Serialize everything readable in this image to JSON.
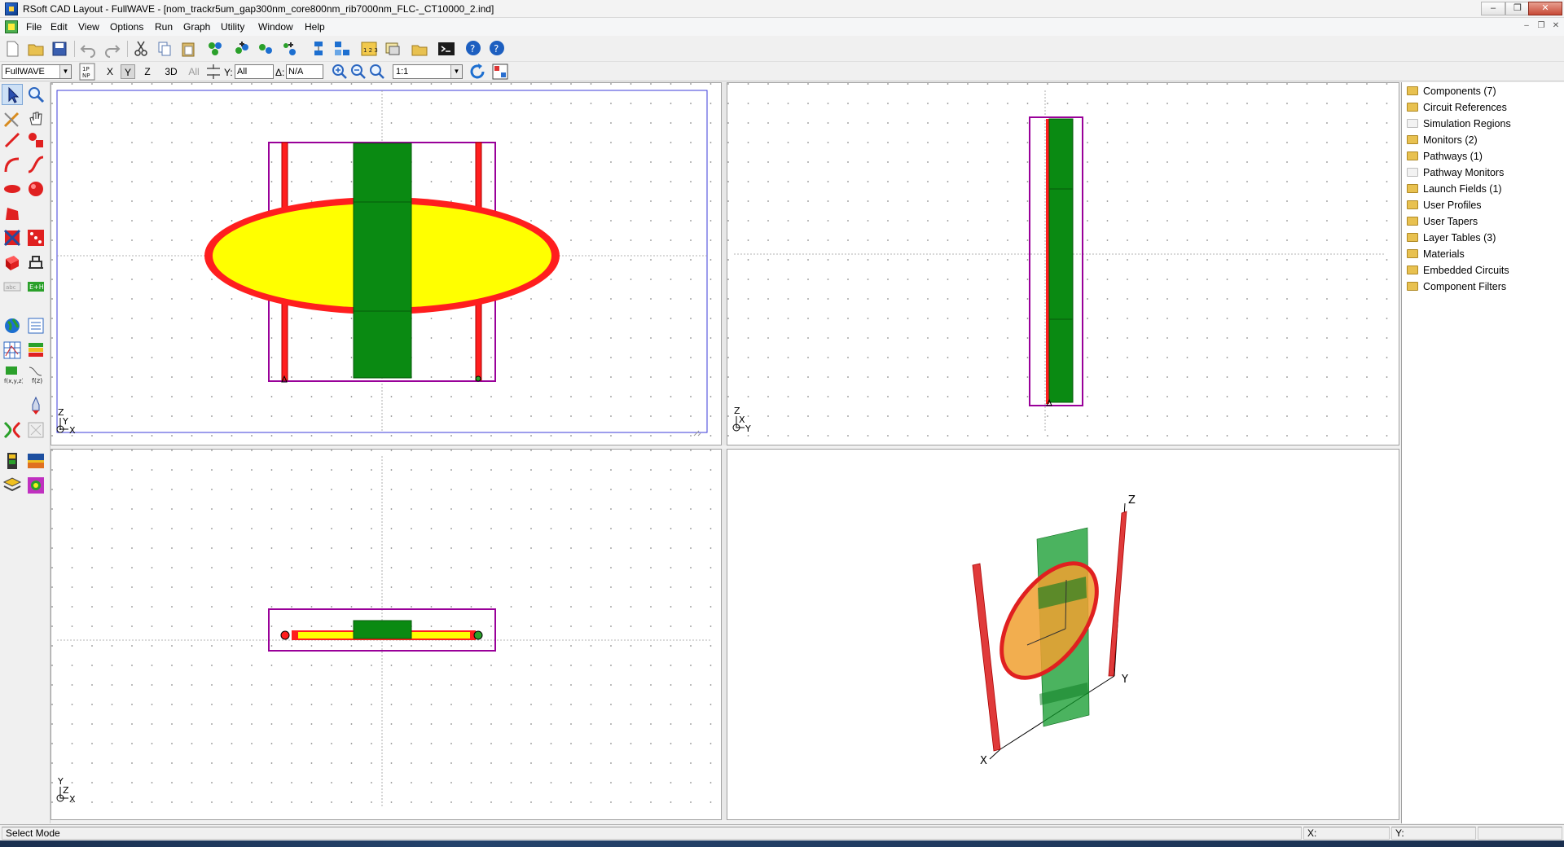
{
  "window": {
    "title": "RSoft CAD Layout - FullWAVE - [nom_trackr5um_gap300nm_core800nm_rib7000nm_FLC-_CT10000_2.ind]",
    "controls": [
      "–",
      "❐",
      "✕"
    ],
    "mdi_controls": [
      "–",
      "❐",
      "✕"
    ]
  },
  "menu": [
    "File",
    "Edit",
    "View",
    "Options",
    "Run",
    "Graph",
    "Utility",
    "Window",
    "Help"
  ],
  "toolbar2": {
    "program": "FullWAVE",
    "axes": [
      "X",
      "Y",
      "Z",
      "3D"
    ],
    "selected_axis": "Y",
    "all_label": "All",
    "y_label": "Y:",
    "y_value": "All",
    "delta_label": "Δ:",
    "delta_value": "N/A",
    "zoom_value": "1:1"
  },
  "views": {
    "top_left_axes": {
      "vertical": "Z",
      "horizontal": "X",
      "depth": "Y"
    },
    "top_right_axes": {
      "vertical": "Z",
      "horizontal": "Y",
      "depth": "X"
    },
    "bottom_left_axes": {
      "vertical": "Y",
      "horizontal": "X",
      "depth": "Z"
    },
    "three_d_axes": {
      "x": "X",
      "y": "Y",
      "z": "Z"
    }
  },
  "tree": [
    {
      "label": "Components (7)",
      "empty": false
    },
    {
      "label": "Circuit References",
      "empty": false
    },
    {
      "label": "Simulation Regions",
      "empty": true
    },
    {
      "label": "Monitors (2)",
      "empty": false
    },
    {
      "label": "Pathways (1)",
      "empty": false
    },
    {
      "label": "Pathway Monitors",
      "empty": true
    },
    {
      "label": "Launch Fields (1)",
      "empty": false
    },
    {
      "label": "User Profiles",
      "empty": false
    },
    {
      "label": "User Tapers",
      "empty": false
    },
    {
      "label": "Layer Tables (3)",
      "empty": false
    },
    {
      "label": "Materials",
      "empty": false
    },
    {
      "label": "Embedded Circuits",
      "empty": false
    },
    {
      "label": "Component Filters",
      "empty": false
    }
  ],
  "status": {
    "mode": "Select Mode",
    "x_label": "X:",
    "y_label": "Y:"
  },
  "colors": {
    "core": "#0a8a12",
    "ring": "#ff1e1e",
    "fill": "#ffff00",
    "frame": "#990099",
    "selection": "#3b3bd8"
  }
}
